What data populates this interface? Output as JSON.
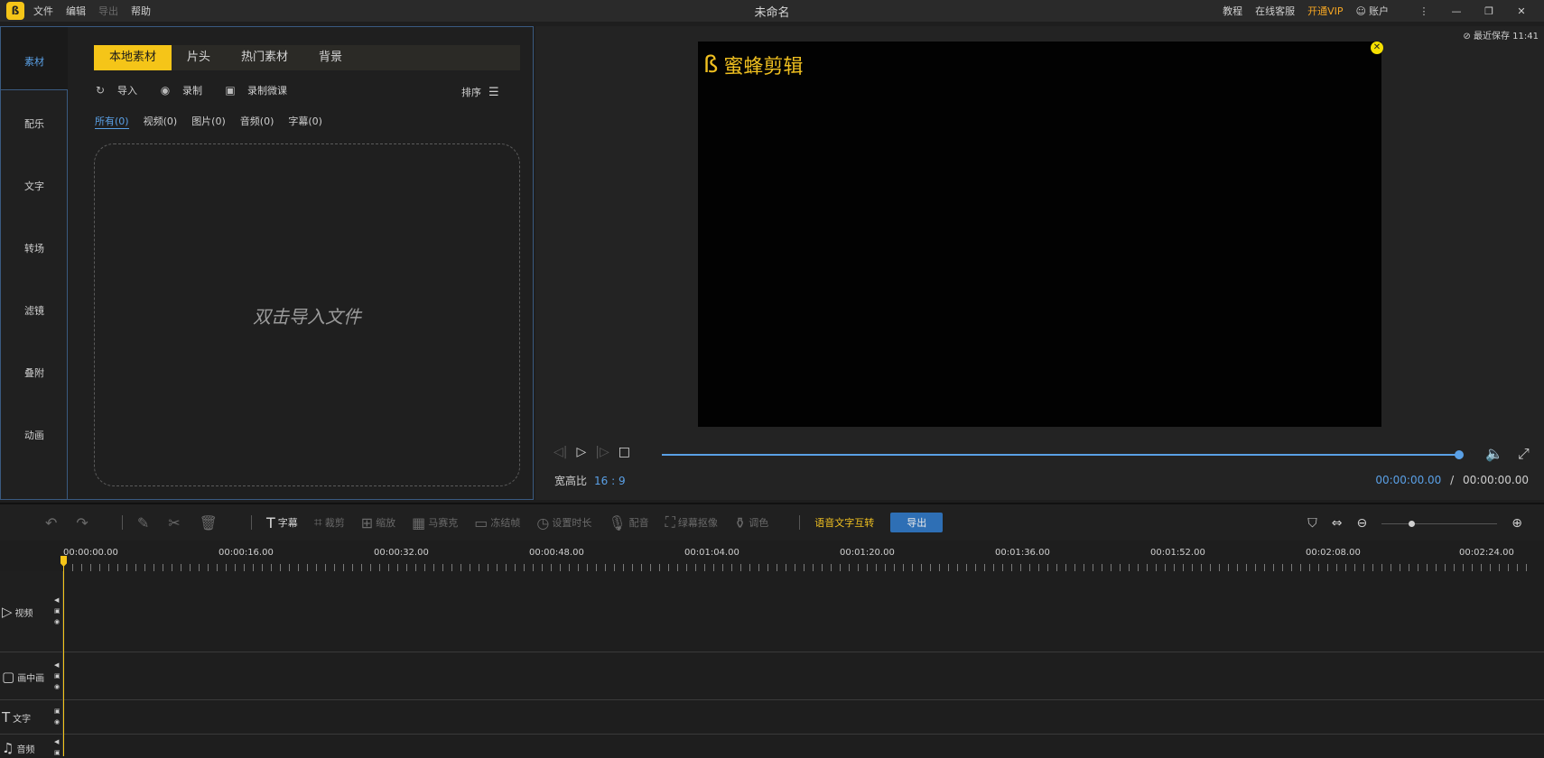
{
  "titlebar": {
    "logo": "bee-logo",
    "menu": [
      "文件",
      "编辑",
      "导出",
      "帮助"
    ],
    "title": "未命名",
    "right": [
      "教程",
      "在线客服",
      "开通VIP",
      "账户"
    ]
  },
  "sidebar": {
    "items": [
      "素材",
      "配乐",
      "文字",
      "转场",
      "滤镜",
      "叠附",
      "动画"
    ],
    "active": "素材"
  },
  "library": {
    "tabs": [
      "本地素材",
      "片头",
      "热门素材",
      "背景"
    ],
    "actions": {
      "import": "导入",
      "record": "录制",
      "record_course": "录制微课"
    },
    "sort": "排序",
    "filters": [
      "所有(0)",
      "视频(0)",
      "图片(0)",
      "音频(0)",
      "字幕(0)"
    ],
    "dropzone": "双击导入文件"
  },
  "preview": {
    "saved": "最近保存 11:41",
    "brand": "蜜蜂剪辑",
    "ratio_label": "宽高比",
    "ratio_value": "16 : 9",
    "current_time": "00:00:00.00",
    "separator": "/",
    "total_time": "00:00:00.00"
  },
  "toolbar": {
    "items": [
      "字幕",
      "裁剪",
      "缩放",
      "马赛克",
      "冻结帧",
      "设置时长",
      "配音",
      "绿幕抠像",
      "调色"
    ],
    "speech_text": "语音文字互转",
    "export": "导出"
  },
  "timeline": {
    "ticks": [
      "00:00:00.00",
      "00:00:16.00",
      "00:00:32.00",
      "00:00:48.00",
      "00:01:04.00",
      "00:01:20.00",
      "00:01:36.00",
      "00:01:52.00",
      "00:02:08.00",
      "00:02:24.00"
    ],
    "tracks": [
      "视频",
      "画中画",
      "文字",
      "音频"
    ]
  },
  "colors": {
    "accent": "#f5c518",
    "blue": "#5aa0e6",
    "vip": "#f5a623"
  }
}
